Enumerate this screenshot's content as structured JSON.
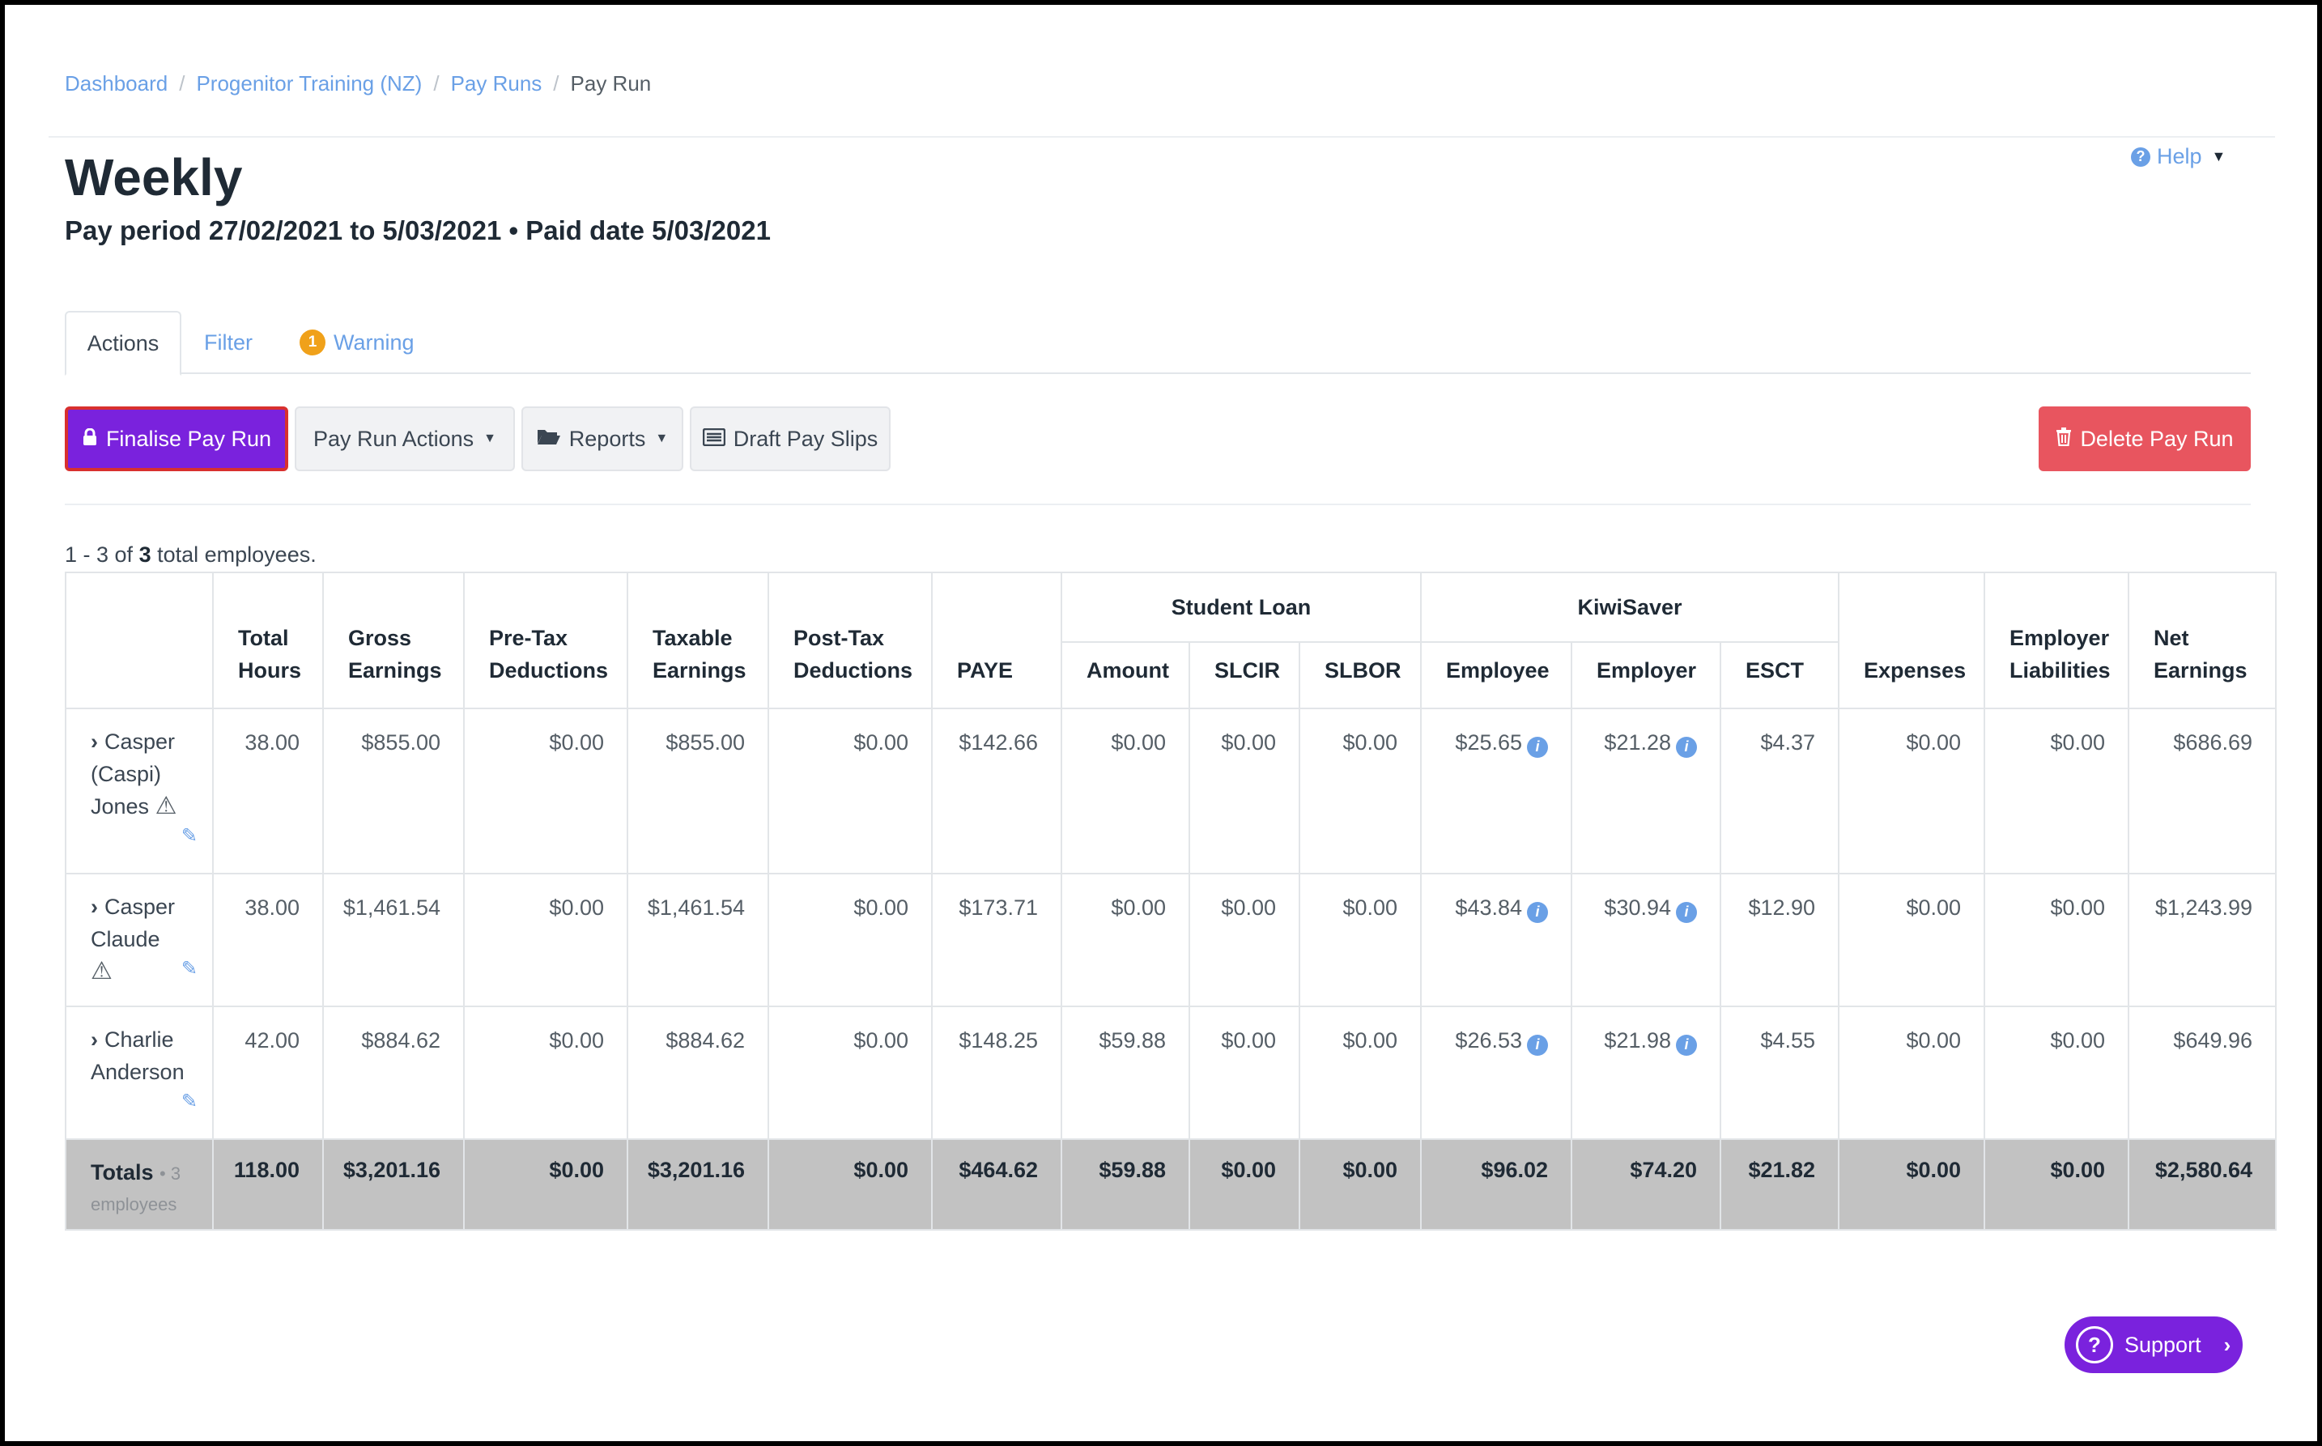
{
  "breadcrumb": {
    "items": [
      "Dashboard",
      "Progenitor Training (NZ)",
      "Pay Runs"
    ],
    "current": "Pay Run"
  },
  "page": {
    "title": "Weekly",
    "subtitle": "Pay period 27/02/2021 to 5/03/2021 • Paid date 5/03/2021"
  },
  "help": {
    "label": "Help"
  },
  "tabs": {
    "actions": "Actions",
    "filter": "Filter",
    "warning": "Warning",
    "warning_count": "1"
  },
  "toolbar": {
    "finalise": "Finalise Pay Run",
    "pay_run_actions": "Pay Run Actions",
    "reports": "Reports",
    "draft_pay_slips": "Draft Pay Slips",
    "delete": "Delete Pay Run"
  },
  "count": {
    "range": "1 - 3 of",
    "total": "3",
    "suffix": "total employees."
  },
  "table": {
    "groups": {
      "student_loan": "Student Loan",
      "kiwisaver": "KiwiSaver"
    },
    "headers": {
      "total_hours": "Total Hours",
      "gross": "Gross Earnings",
      "pretax": "Pre-Tax Deductions",
      "taxable": "Taxable Earnings",
      "posttax": "Post-Tax Deductions",
      "paye": "PAYE",
      "sl_amount": "Amount",
      "slcir": "SLCIR",
      "slbor": "SLBOR",
      "ks_employee": "Employee",
      "ks_employer": "Employer",
      "esct": "ESCT",
      "expenses": "Expenses",
      "employer_liabilities": "Employer Liabilities",
      "net": "Net Earnings"
    },
    "rows": [
      {
        "name_lines": [
          "Casper",
          "(Caspi)",
          "Jones"
        ],
        "hours": "38.00",
        "gross": "$855.00",
        "pretax": "$0.00",
        "taxable": "$855.00",
        "posttax": "$0.00",
        "paye": "$142.66",
        "sl_amount": "$0.00",
        "slcir": "$0.00",
        "slbor": "$0.00",
        "ks_employee": "$25.65",
        "ks_employer": "$21.28",
        "esct": "$4.37",
        "expenses": "$0.00",
        "employer_liabilities": "$0.00",
        "net": "$686.69"
      },
      {
        "name_lines": [
          "Casper",
          "Claude"
        ],
        "hours": "38.00",
        "gross": "$1,461.54",
        "pretax": "$0.00",
        "taxable": "$1,461.54",
        "posttax": "$0.00",
        "paye": "$173.71",
        "sl_amount": "$0.00",
        "slcir": "$0.00",
        "slbor": "$0.00",
        "ks_employee": "$43.84",
        "ks_employer": "$30.94",
        "esct": "$12.90",
        "expenses": "$0.00",
        "employer_liabilities": "$0.00",
        "net": "$1,243.99"
      },
      {
        "name_lines": [
          "Charlie",
          "Anderson"
        ],
        "hours": "42.00",
        "gross": "$884.62",
        "pretax": "$0.00",
        "taxable": "$884.62",
        "posttax": "$0.00",
        "paye": "$148.25",
        "sl_amount": "$59.88",
        "slcir": "$0.00",
        "slbor": "$0.00",
        "ks_employee": "$26.53",
        "ks_employer": "$21.98",
        "esct": "$4.55",
        "expenses": "$0.00",
        "employer_liabilities": "$0.00",
        "net": "$649.96"
      }
    ],
    "totals": {
      "label": "Totals",
      "sub": "• 3 employees",
      "hours": "118.00",
      "gross": "$3,201.16",
      "pretax": "$0.00",
      "taxable": "$3,201.16",
      "posttax": "$0.00",
      "paye": "$464.62",
      "sl_amount": "$59.88",
      "slcir": "$0.00",
      "slbor": "$0.00",
      "ks_employee": "$96.02",
      "ks_employer": "$74.20",
      "esct": "$21.82",
      "expenses": "$0.00",
      "employer_liabilities": "$0.00",
      "net": "$2,580.64"
    }
  },
  "support": {
    "label": "Support"
  },
  "colors": {
    "accent_purple": "#7a22dd",
    "danger": "#e8555f",
    "link": "#6aa0e6",
    "warning": "#f0a11a",
    "totals_bg": "#c2c2c2"
  },
  "icons": [
    "lock-icon",
    "folder-open-icon",
    "list-icon",
    "trash-icon",
    "chevron-right-icon",
    "warning-icon",
    "pencil-icon",
    "info-icon",
    "question-circle-icon"
  ]
}
